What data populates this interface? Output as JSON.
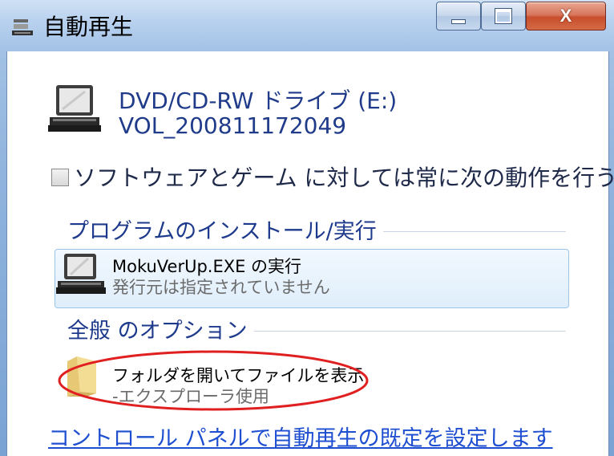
{
  "window": {
    "title": "自動再生",
    "controls": {
      "minimize": "minimize-icon",
      "maximize": "maximize-icon",
      "close": "close-icon"
    }
  },
  "drive": {
    "name": "DVD/CD-RW ドライブ (E:)",
    "volume": "VOL_200811172049",
    "icon": "computer-drive-icon"
  },
  "always_checkbox": {
    "checked": false,
    "label": "ソフトウェアとゲーム に対しては常に次の動作を行う:"
  },
  "section_install": {
    "label": "プログラムのインストール/実行",
    "action": {
      "title": "MokuVerUp.EXE の実行",
      "subtitle": "発行元は指定されていません",
      "icon": "computer-icon"
    }
  },
  "section_general": {
    "label": "全般 のオプション",
    "option": {
      "title": "フォルダを開いてファイルを表示",
      "subtitle": "-エクスプローラ使用",
      "icon": "folder-icon",
      "highlight_color": "#e02020"
    }
  },
  "footer_link": "コントロール パネルで自動再生の既定を設定します"
}
